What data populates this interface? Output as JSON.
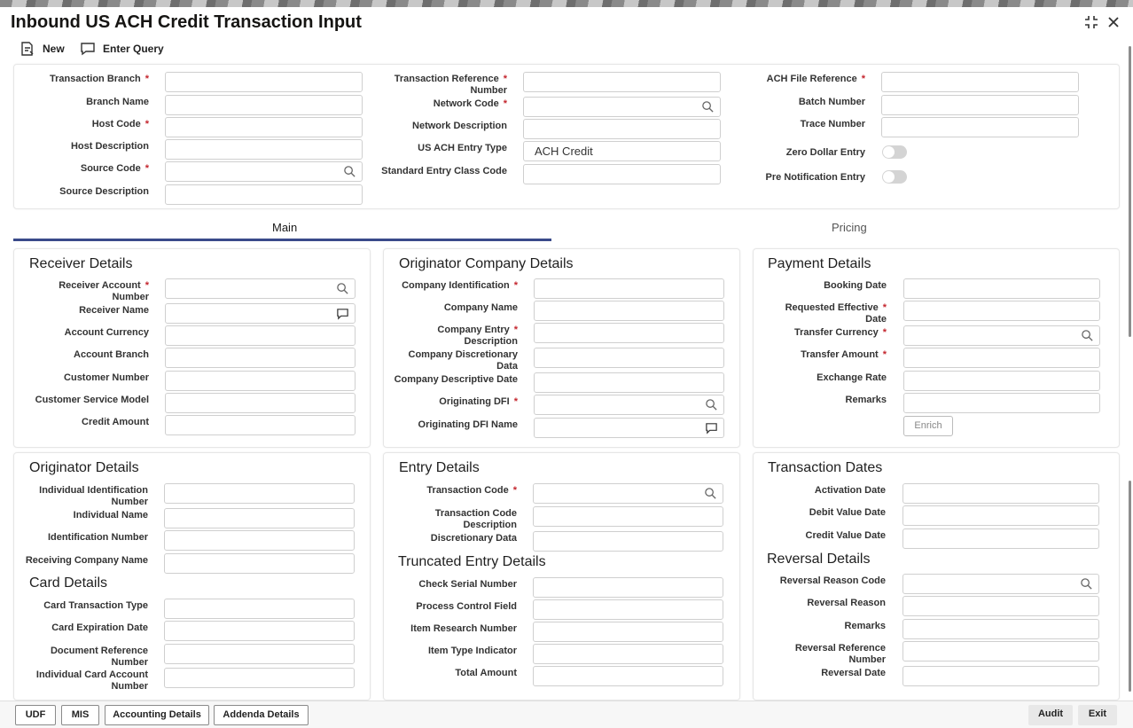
{
  "window": {
    "title": "Inbound US ACH Credit Transaction Input"
  },
  "toolbar": {
    "new_label": "New",
    "enter_query_label": "Enter Query"
  },
  "header": {
    "transaction_branch": "Transaction Branch",
    "branch_name": "Branch Name",
    "host_code": "Host Code",
    "host_description": "Host Description",
    "source_code": "Source Code",
    "source_description": "Source Description",
    "transaction_reference_1": "Transaction Reference",
    "transaction_reference_2": "Number",
    "network_code": "Network Code",
    "network_description": "Network Description",
    "us_ach_entry_type": "US ACH Entry Type",
    "us_ach_entry_type_value": "ACH Credit",
    "standard_entry_class_code": "Standard Entry Class Code",
    "ach_file_reference": "ACH File Reference",
    "batch_number": "Batch Number",
    "trace_number": "Trace Number",
    "zero_dollar_entry": "Zero Dollar Entry",
    "pre_notification_entry": "Pre Notification Entry",
    "required_mark": "*"
  },
  "tabs": {
    "main": "Main",
    "pricing": "Pricing"
  },
  "receiver": {
    "title": "Receiver Details",
    "account_number_1": "Receiver Account",
    "account_number_2": "Number",
    "receiver_name": "Receiver Name",
    "account_currency": "Account Currency",
    "account_branch": "Account Branch",
    "customer_number": "Customer Number",
    "customer_service_model": "Customer Service Model",
    "credit_amount": "Credit Amount"
  },
  "originator_company": {
    "title": "Originator Company Details",
    "company_identification": "Company Identification",
    "company_name": "Company Name",
    "company_entry_desc_1": "Company Entry",
    "company_entry_desc_2": "Description",
    "company_discretionary_1": "Company Discretionary",
    "company_discretionary_2": "Data",
    "company_descriptive_date": "Company Descriptive Date",
    "originating_dfi": "Originating DFI",
    "originating_dfi_name": "Originating DFI Name"
  },
  "payment": {
    "title": "Payment Details",
    "booking_date": "Booking Date",
    "requested_effective_1": "Requested Effective",
    "requested_effective_2": "Date",
    "transfer_currency": "Transfer Currency",
    "transfer_amount": "Transfer Amount",
    "exchange_rate": "Exchange Rate",
    "remarks": "Remarks",
    "enrich_label": "Enrich"
  },
  "originator": {
    "title": "Originator Details",
    "individual_id_1": "Individual Identification",
    "individual_id_2": "Number",
    "individual_name": "Individual Name",
    "identification_number": "Identification Number",
    "receiving_company_name": "Receiving Company Name"
  },
  "card": {
    "title": "Card Details",
    "card_transaction_type": "Card Transaction Type",
    "card_expiration_date": "Card Expiration Date",
    "document_reference_1": "Document Reference",
    "document_reference_2": "Number",
    "individual_card_1": "Individual Card Account",
    "individual_card_2": "Number"
  },
  "entry": {
    "title": "Entry Details",
    "transaction_code": "Transaction Code",
    "transaction_code_desc_1": "Transaction Code",
    "transaction_code_desc_2": "Description",
    "discretionary_data": "Discretionary Data"
  },
  "truncated": {
    "title": "Truncated Entry Details",
    "check_serial_number": "Check Serial Number",
    "process_control_field": "Process Control Field",
    "item_research_number": "Item Research Number",
    "item_type_indicator": "Item Type Indicator",
    "total_amount": "Total Amount"
  },
  "transaction_dates": {
    "title": "Transaction Dates",
    "activation_date": "Activation Date",
    "debit_value_date": "Debit Value Date",
    "credit_value_date": "Credit Value Date"
  },
  "reversal": {
    "title": "Reversal Details",
    "reversal_reason_code": "Reversal Reason Code",
    "reversal_reason": "Reversal Reason",
    "remarks": "Remarks",
    "reversal_reference_1": "Reversal Reference",
    "reversal_reference_2": "Number",
    "reversal_date": "Reversal Date"
  },
  "footer": {
    "udf": "UDF",
    "mis": "MIS",
    "accounting_details": "Accounting Details",
    "addenda_details": "Addenda Details",
    "audit": "Audit",
    "exit": "Exit"
  },
  "colors": {
    "accent_tab_underline": "#3a4a8a",
    "required": "#c4262e"
  }
}
